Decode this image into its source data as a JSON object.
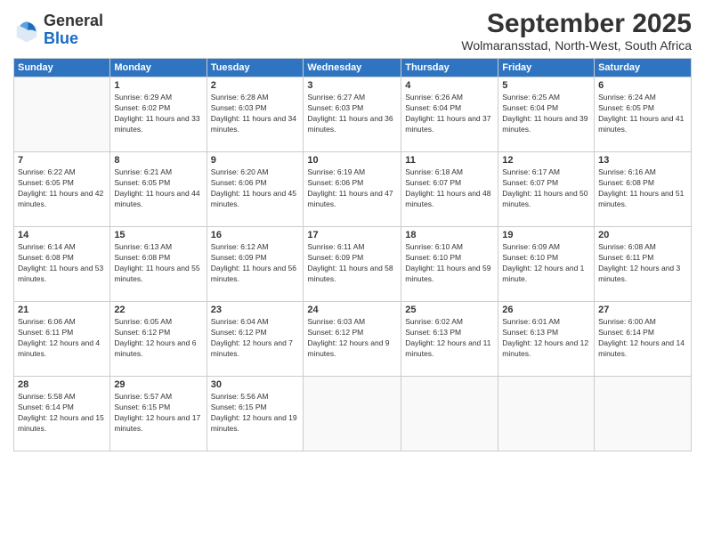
{
  "logo": {
    "general": "General",
    "blue": "Blue"
  },
  "title": "September 2025",
  "subtitle": "Wolmaransstad, North-West, South Africa",
  "days": [
    "Sunday",
    "Monday",
    "Tuesday",
    "Wednesday",
    "Thursday",
    "Friday",
    "Saturday"
  ],
  "weeks": [
    [
      {
        "date": "",
        "sunrise": "",
        "sunset": "",
        "daylight": ""
      },
      {
        "date": "1",
        "sunrise": "Sunrise: 6:29 AM",
        "sunset": "Sunset: 6:02 PM",
        "daylight": "Daylight: 11 hours and 33 minutes."
      },
      {
        "date": "2",
        "sunrise": "Sunrise: 6:28 AM",
        "sunset": "Sunset: 6:03 PM",
        "daylight": "Daylight: 11 hours and 34 minutes."
      },
      {
        "date": "3",
        "sunrise": "Sunrise: 6:27 AM",
        "sunset": "Sunset: 6:03 PM",
        "daylight": "Daylight: 11 hours and 36 minutes."
      },
      {
        "date": "4",
        "sunrise": "Sunrise: 6:26 AM",
        "sunset": "Sunset: 6:04 PM",
        "daylight": "Daylight: 11 hours and 37 minutes."
      },
      {
        "date": "5",
        "sunrise": "Sunrise: 6:25 AM",
        "sunset": "Sunset: 6:04 PM",
        "daylight": "Daylight: 11 hours and 39 minutes."
      },
      {
        "date": "6",
        "sunrise": "Sunrise: 6:24 AM",
        "sunset": "Sunset: 6:05 PM",
        "daylight": "Daylight: 11 hours and 41 minutes."
      }
    ],
    [
      {
        "date": "7",
        "sunrise": "Sunrise: 6:22 AM",
        "sunset": "Sunset: 6:05 PM",
        "daylight": "Daylight: 11 hours and 42 minutes."
      },
      {
        "date": "8",
        "sunrise": "Sunrise: 6:21 AM",
        "sunset": "Sunset: 6:05 PM",
        "daylight": "Daylight: 11 hours and 44 minutes."
      },
      {
        "date": "9",
        "sunrise": "Sunrise: 6:20 AM",
        "sunset": "Sunset: 6:06 PM",
        "daylight": "Daylight: 11 hours and 45 minutes."
      },
      {
        "date": "10",
        "sunrise": "Sunrise: 6:19 AM",
        "sunset": "Sunset: 6:06 PM",
        "daylight": "Daylight: 11 hours and 47 minutes."
      },
      {
        "date": "11",
        "sunrise": "Sunrise: 6:18 AM",
        "sunset": "Sunset: 6:07 PM",
        "daylight": "Daylight: 11 hours and 48 minutes."
      },
      {
        "date": "12",
        "sunrise": "Sunrise: 6:17 AM",
        "sunset": "Sunset: 6:07 PM",
        "daylight": "Daylight: 11 hours and 50 minutes."
      },
      {
        "date": "13",
        "sunrise": "Sunrise: 6:16 AM",
        "sunset": "Sunset: 6:08 PM",
        "daylight": "Daylight: 11 hours and 51 minutes."
      }
    ],
    [
      {
        "date": "14",
        "sunrise": "Sunrise: 6:14 AM",
        "sunset": "Sunset: 6:08 PM",
        "daylight": "Daylight: 11 hours and 53 minutes."
      },
      {
        "date": "15",
        "sunrise": "Sunrise: 6:13 AM",
        "sunset": "Sunset: 6:08 PM",
        "daylight": "Daylight: 11 hours and 55 minutes."
      },
      {
        "date": "16",
        "sunrise": "Sunrise: 6:12 AM",
        "sunset": "Sunset: 6:09 PM",
        "daylight": "Daylight: 11 hours and 56 minutes."
      },
      {
        "date": "17",
        "sunrise": "Sunrise: 6:11 AM",
        "sunset": "Sunset: 6:09 PM",
        "daylight": "Daylight: 11 hours and 58 minutes."
      },
      {
        "date": "18",
        "sunrise": "Sunrise: 6:10 AM",
        "sunset": "Sunset: 6:10 PM",
        "daylight": "Daylight: 11 hours and 59 minutes."
      },
      {
        "date": "19",
        "sunrise": "Sunrise: 6:09 AM",
        "sunset": "Sunset: 6:10 PM",
        "daylight": "Daylight: 12 hours and 1 minute."
      },
      {
        "date": "20",
        "sunrise": "Sunrise: 6:08 AM",
        "sunset": "Sunset: 6:11 PM",
        "daylight": "Daylight: 12 hours and 3 minutes."
      }
    ],
    [
      {
        "date": "21",
        "sunrise": "Sunrise: 6:06 AM",
        "sunset": "Sunset: 6:11 PM",
        "daylight": "Daylight: 12 hours and 4 minutes."
      },
      {
        "date": "22",
        "sunrise": "Sunrise: 6:05 AM",
        "sunset": "Sunset: 6:12 PM",
        "daylight": "Daylight: 12 hours and 6 minutes."
      },
      {
        "date": "23",
        "sunrise": "Sunrise: 6:04 AM",
        "sunset": "Sunset: 6:12 PM",
        "daylight": "Daylight: 12 hours and 7 minutes."
      },
      {
        "date": "24",
        "sunrise": "Sunrise: 6:03 AM",
        "sunset": "Sunset: 6:12 PM",
        "daylight": "Daylight: 12 hours and 9 minutes."
      },
      {
        "date": "25",
        "sunrise": "Sunrise: 6:02 AM",
        "sunset": "Sunset: 6:13 PM",
        "daylight": "Daylight: 12 hours and 11 minutes."
      },
      {
        "date": "26",
        "sunrise": "Sunrise: 6:01 AM",
        "sunset": "Sunset: 6:13 PM",
        "daylight": "Daylight: 12 hours and 12 minutes."
      },
      {
        "date": "27",
        "sunrise": "Sunrise: 6:00 AM",
        "sunset": "Sunset: 6:14 PM",
        "daylight": "Daylight: 12 hours and 14 minutes."
      }
    ],
    [
      {
        "date": "28",
        "sunrise": "Sunrise: 5:58 AM",
        "sunset": "Sunset: 6:14 PM",
        "daylight": "Daylight: 12 hours and 15 minutes."
      },
      {
        "date": "29",
        "sunrise": "Sunrise: 5:57 AM",
        "sunset": "Sunset: 6:15 PM",
        "daylight": "Daylight: 12 hours and 17 minutes."
      },
      {
        "date": "30",
        "sunrise": "Sunrise: 5:56 AM",
        "sunset": "Sunset: 6:15 PM",
        "daylight": "Daylight: 12 hours and 19 minutes."
      },
      {
        "date": "",
        "sunrise": "",
        "sunset": "",
        "daylight": ""
      },
      {
        "date": "",
        "sunrise": "",
        "sunset": "",
        "daylight": ""
      },
      {
        "date": "",
        "sunrise": "",
        "sunset": "",
        "daylight": ""
      },
      {
        "date": "",
        "sunrise": "",
        "sunset": "",
        "daylight": ""
      }
    ]
  ]
}
